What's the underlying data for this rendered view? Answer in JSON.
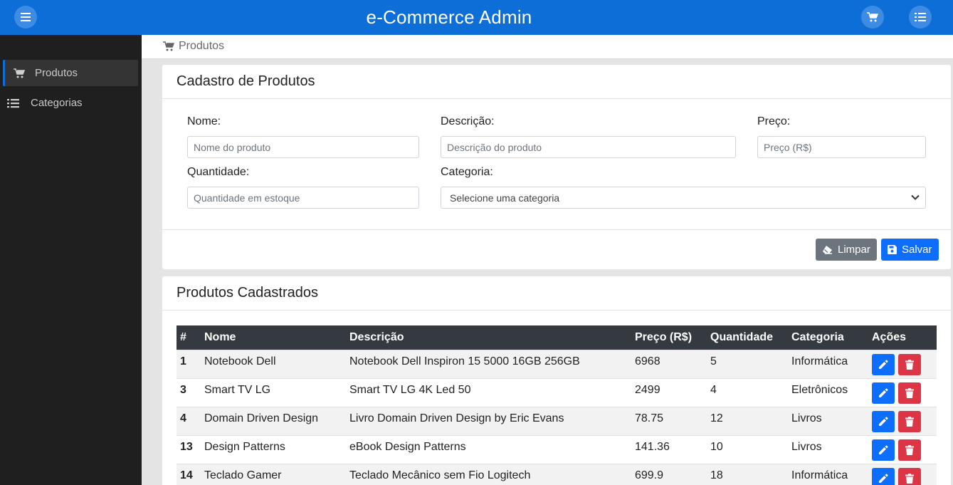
{
  "app": {
    "title": "e-Commerce Admin"
  },
  "topbar": {
    "menu_icon": "hamburger-icon",
    "cart_icon": "cart-icon",
    "list_icon": "list-icon"
  },
  "sidebar": {
    "items": [
      {
        "label": "Produtos",
        "icon": "cart-icon",
        "active": true
      },
      {
        "label": "Categorias",
        "icon": "list-icon",
        "active": false
      }
    ]
  },
  "breadcrumb": {
    "label": "Produtos",
    "icon": "cart-icon"
  },
  "form": {
    "title": "Cadastro de Produtos",
    "nome_label": "Nome:",
    "nome_placeholder": "Nome do produto",
    "descricao_label": "Descrição:",
    "descricao_placeholder": "Descrição do produto",
    "preco_label": "Preço:",
    "preco_placeholder": "Preço (R$)",
    "quantidade_label": "Quantidade:",
    "quantidade_placeholder": "Quantidade em estoque",
    "categoria_label": "Categoria:",
    "categoria_selected": "Selecione uma categoria",
    "clear_label": "Limpar",
    "save_label": "Salvar"
  },
  "list": {
    "title": "Produtos Cadastrados",
    "columns": [
      "#",
      "Nome",
      "Descrição",
      "Preço (R$)",
      "Quantidade",
      "Categoria",
      "Ações"
    ],
    "rows": [
      {
        "id": "1",
        "nome": "Notebook Dell",
        "descricao": "Notebook Dell Inspiron 15 5000 16GB 256GB",
        "preco": "6968",
        "quantidade": "5",
        "categoria": "Informática"
      },
      {
        "id": "3",
        "nome": "Smart TV LG",
        "descricao": "Smart TV LG 4K Led 50",
        "preco": "2499",
        "quantidade": "4",
        "categoria": "Eletrônicos"
      },
      {
        "id": "4",
        "nome": "Domain Driven Design",
        "descricao": "Livro Domain Driven Design by Eric Evans",
        "preco": "78.75",
        "quantidade": "12",
        "categoria": "Livros"
      },
      {
        "id": "13",
        "nome": "Design Patterns",
        "descricao": "eBook Design Patterns",
        "preco": "141.36",
        "quantidade": "10",
        "categoria": "Livros"
      },
      {
        "id": "14",
        "nome": "Teclado Gamer",
        "descricao": "Teclado Mecânico sem Fio Logitech",
        "preco": "699.9",
        "quantidade": "18",
        "categoria": "Informática"
      }
    ]
  },
  "colors": {
    "primary": "#0d6ed8",
    "sidebar": "#1f1f1f",
    "danger": "#dc3545",
    "secondary": "#6c757d",
    "table_head": "#343a40"
  }
}
